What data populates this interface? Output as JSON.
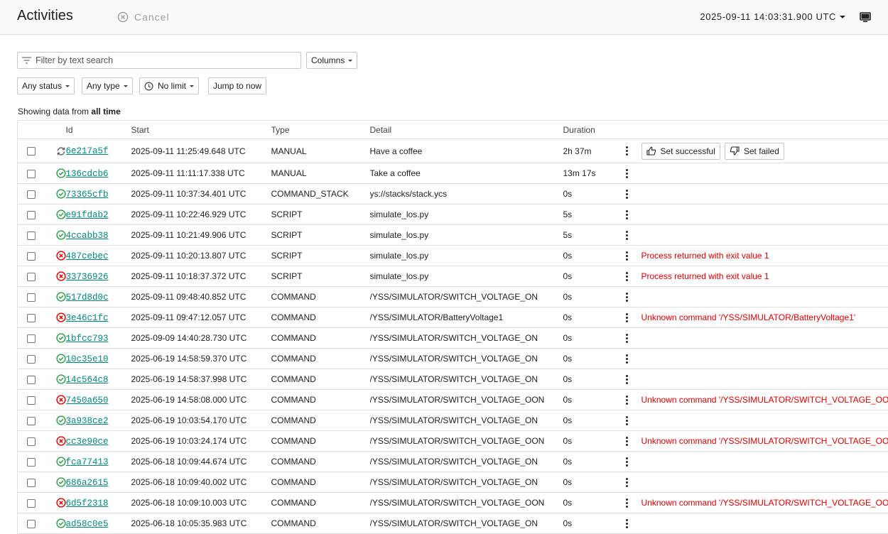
{
  "header": {
    "title": "Activities",
    "cancel_label": "Cancel",
    "clock": "2025-09-11 14:03:31.900 UTC"
  },
  "toolbar": {
    "filter_placeholder": "Filter by text search",
    "columns_label": "Columns",
    "status_label": "Any status",
    "type_label": "Any type",
    "limit_label": "No limit",
    "jump_label": "Jump to now"
  },
  "showing": {
    "prefix": "Showing data from ",
    "range": "all time"
  },
  "columns": [
    "Id",
    "Start",
    "Type",
    "Detail",
    "Duration"
  ],
  "rows": [
    {
      "status": "running",
      "id": "6e217a5f",
      "start": "2025-09-11 11:25:49.648 UTC",
      "type": "MANUAL",
      "detail": "Have a coffee",
      "duration": "2h 37m",
      "message": ""
    },
    {
      "status": "success",
      "id": "136cdcb6",
      "start": "2025-09-11 11:11:17.338 UTC",
      "type": "MANUAL",
      "detail": "Take a coffee",
      "duration": "13m 17s",
      "message": ""
    },
    {
      "status": "success",
      "id": "73365cfb",
      "start": "2025-09-11 10:37:34.401 UTC",
      "type": "COMMAND_STACK",
      "detail": "ys://stacks/stack.ycs",
      "duration": "0s",
      "message": ""
    },
    {
      "status": "success",
      "id": "e91fdab2",
      "start": "2025-09-11 10:22:46.929 UTC",
      "type": "SCRIPT",
      "detail": "simulate_los.py",
      "duration": "5s",
      "message": ""
    },
    {
      "status": "success",
      "id": "4ccabb38",
      "start": "2025-09-11 10:21:49.906 UTC",
      "type": "SCRIPT",
      "detail": "simulate_los.py",
      "duration": "5s",
      "message": ""
    },
    {
      "status": "failed",
      "id": "487cebec",
      "start": "2025-09-11 10:20:13.807 UTC",
      "type": "SCRIPT",
      "detail": "simulate_los.py",
      "duration": "0s",
      "message": "Process returned with exit value 1"
    },
    {
      "status": "failed",
      "id": "33736926",
      "start": "2025-09-11 10:18:37.372 UTC",
      "type": "SCRIPT",
      "detail": "simulate_los.py",
      "duration": "0s",
      "message": "Process returned with exit value 1"
    },
    {
      "status": "success",
      "id": "517d8d0c",
      "start": "2025-09-11 09:48:40.852 UTC",
      "type": "COMMAND",
      "detail": "/YSS/SIMULATOR/SWITCH_VOLTAGE_ON",
      "duration": "0s",
      "message": ""
    },
    {
      "status": "failed",
      "id": "3e46c1fc",
      "start": "2025-09-11 09:47:12.057 UTC",
      "type": "COMMAND",
      "detail": "/YSS/SIMULATOR/BatteryVoltage1",
      "duration": "0s",
      "message": "Unknown command '/YSS/SIMULATOR/BatteryVoltage1'"
    },
    {
      "status": "success",
      "id": "1bfcc793",
      "start": "2025-09-09 14:40:28.730 UTC",
      "type": "COMMAND",
      "detail": "/YSS/SIMULATOR/SWITCH_VOLTAGE_ON",
      "duration": "0s",
      "message": ""
    },
    {
      "status": "success",
      "id": "10c35e10",
      "start": "2025-06-19 14:58:59.370 UTC",
      "type": "COMMAND",
      "detail": "/YSS/SIMULATOR/SWITCH_VOLTAGE_ON",
      "duration": "0s",
      "message": ""
    },
    {
      "status": "success",
      "id": "14c564c8",
      "start": "2025-06-19 14:58:37.998 UTC",
      "type": "COMMAND",
      "detail": "/YSS/SIMULATOR/SWITCH_VOLTAGE_ON",
      "duration": "0s",
      "message": ""
    },
    {
      "status": "failed",
      "id": "7450a650",
      "start": "2025-06-19 14:58:08.000 UTC",
      "type": "COMMAND",
      "detail": "/YSS/SIMULATOR/SWITCH_VOLTAGE_OON",
      "duration": "0s",
      "message": "Unknown command '/YSS/SIMULATOR/SWITCH_VOLTAGE_OON'"
    },
    {
      "status": "success",
      "id": "3a938ce2",
      "start": "2025-06-19 10:03:54.170 UTC",
      "type": "COMMAND",
      "detail": "/YSS/SIMULATOR/SWITCH_VOLTAGE_ON",
      "duration": "0s",
      "message": ""
    },
    {
      "status": "failed",
      "id": "cc3e90ce",
      "start": "2025-06-19 10:03:24.174 UTC",
      "type": "COMMAND",
      "detail": "/YSS/SIMULATOR/SWITCH_VOLTAGE_OON",
      "duration": "0s",
      "message": "Unknown command '/YSS/SIMULATOR/SWITCH_VOLTAGE_OON'"
    },
    {
      "status": "success",
      "id": "fca77413",
      "start": "2025-06-18 10:09:44.674 UTC",
      "type": "COMMAND",
      "detail": "/YSS/SIMULATOR/SWITCH_VOLTAGE_ON",
      "duration": "0s",
      "message": ""
    },
    {
      "status": "success",
      "id": "686a2615",
      "start": "2025-06-18 10:09:40.002 UTC",
      "type": "COMMAND",
      "detail": "/YSS/SIMULATOR/SWITCH_VOLTAGE_ON",
      "duration": "0s",
      "message": ""
    },
    {
      "status": "failed",
      "id": "6d5f2318",
      "start": "2025-06-18 10:09:10.003 UTC",
      "type": "COMMAND",
      "detail": "/YSS/SIMULATOR/SWITCH_VOLTAGE_OON",
      "duration": "0s",
      "message": "Unknown command '/YSS/SIMULATOR/SWITCH_VOLTAGE_OON'"
    },
    {
      "status": "success",
      "id": "ad58c0e5",
      "start": "2025-06-18 10:05:35.983 UTC",
      "type": "COMMAND",
      "detail": "/YSS/SIMULATOR/SWITCH_VOLTAGE_ON",
      "duration": "0s",
      "message": ""
    }
  ],
  "row_actions": {
    "set_successful": "Set successful",
    "set_failed": "Set failed"
  },
  "colors": {
    "success": "#2e9e4a",
    "failed": "#e00000",
    "link": "#00897b",
    "running": "#616161"
  }
}
